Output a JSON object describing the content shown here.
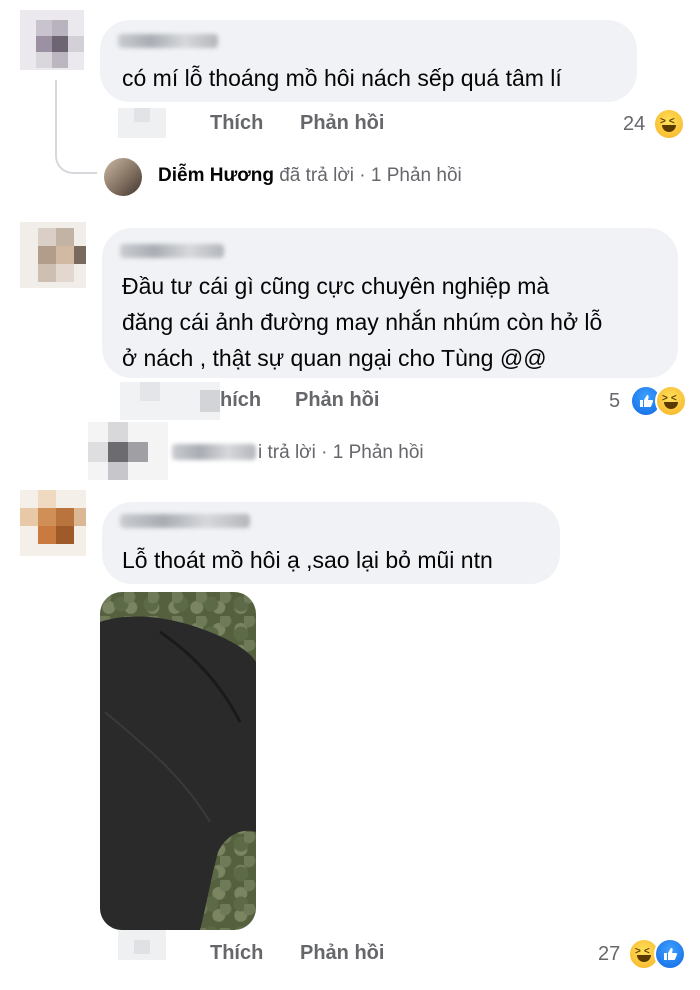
{
  "comments": [
    {
      "text_lines": [
        "có mí lỗ thoáng mồ hôi nách sếp quá tâm lí"
      ],
      "actions": {
        "like": "Thích",
        "reply": "Phản hồi"
      },
      "reaction_count": "24",
      "reactions": [
        "haha-icon"
      ],
      "reply_summary": {
        "name": "Diễm Hương",
        "verb": "đã trả lời",
        "sep": "·",
        "count": "1 Phản hồi"
      }
    },
    {
      "text_lines": [
        "Đầu tư cái gì cũng cực chuyên nghiệp mà",
        "đăng cái ảnh đường may nhắn nhúm còn hở lỗ",
        "ở nách , thật sự quan ngại cho Tùng @@"
      ],
      "actions": {
        "like": "hích",
        "reply": "Phản hồi"
      },
      "reaction_count": "5",
      "reactions": [
        "like-icon",
        "haha-icon"
      ],
      "reply_summary": {
        "verb": "i trả lời",
        "sep": "·",
        "count": "1 Phản hồi"
      }
    },
    {
      "text_lines": [
        "Lỗ thoát mồ hôi ạ ,sao lại bỏ mũi ntn"
      ],
      "actions": {
        "like": "Thích",
        "reply": "Phản hồi"
      },
      "reaction_count": "27",
      "reactions": [
        "haha-icon",
        "like-icon"
      ]
    }
  ],
  "colors": {
    "bubble": "#f0f2f5",
    "meta": "#65676b",
    "text": "#050505",
    "like_blue": "#1877f2",
    "haha_yellow": "#f7b125"
  }
}
